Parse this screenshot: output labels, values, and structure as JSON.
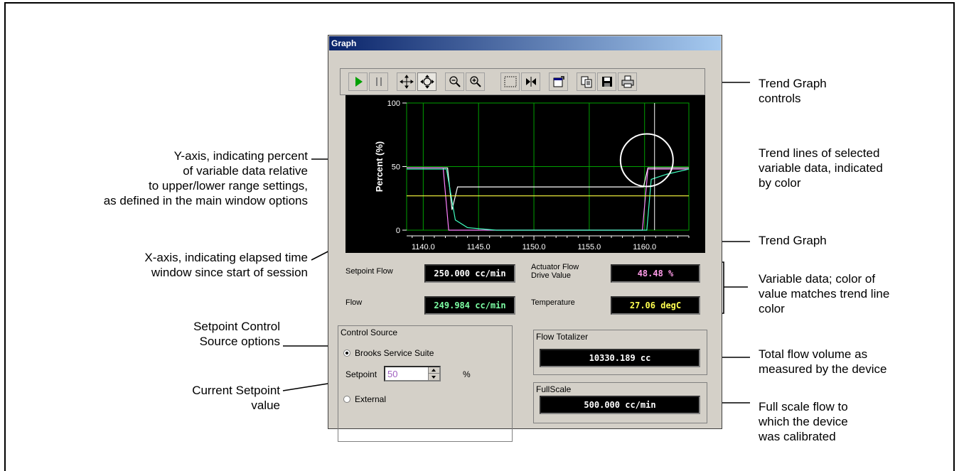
{
  "window": {
    "title": "Graph"
  },
  "toolbar": {
    "buttons": [
      "play-icon",
      "pause-icon",
      "pan-icon",
      "zoom-area-icon",
      "zoom-out-icon",
      "zoom-in-icon",
      "select-box-icon",
      "fit-icon",
      "properties-icon",
      "copy-icon",
      "save-icon",
      "print-icon"
    ]
  },
  "chart_data": {
    "type": "line",
    "ylabel": "Percent (%)",
    "ylim": [
      0,
      100
    ],
    "xlim": [
      1138.5,
      1164.0
    ],
    "y_ticks": [
      "100",
      "50",
      "0"
    ],
    "x_ticks": [
      "1140.0",
      "1145.0",
      "1150.0",
      "1155.0",
      "1160.0"
    ],
    "series": [
      {
        "color": "#ffffff",
        "x": [
          1138.5,
          1142.2,
          1142.6,
          1143.1,
          1159.9,
          1160.3,
          1164.0
        ],
        "y": [
          49,
          49,
          16,
          34,
          34,
          49,
          49
        ]
      },
      {
        "color": "#ff80ff",
        "x": [
          1138.5,
          1141.8,
          1142.3,
          1159.8,
          1160.3,
          1164.0
        ],
        "y": [
          49,
          49,
          0,
          0,
          48,
          48
        ]
      },
      {
        "color": "#40ffc0",
        "x": [
          1138.5,
          1142.1,
          1142.9,
          1144.0,
          1146.6,
          1159.7,
          1160.2,
          1160.6,
          1162.0,
          1164.0
        ],
        "y": [
          48,
          48,
          8,
          2,
          0,
          0,
          0,
          40,
          44,
          48
        ]
      },
      {
        "color": "#ffff40",
        "x": [
          1138.5,
          1164.0
        ],
        "y": [
          27,
          27
        ]
      }
    ]
  },
  "fields": {
    "setpoint_flow": {
      "label": "Setpoint Flow",
      "value": "250.000 cc/min",
      "color": "#ffffff"
    },
    "actuator": {
      "label_1": "Actuator Flow",
      "label_2": "Drive Value",
      "value": "48.48 %",
      "color": "#ff9be8"
    },
    "flow": {
      "label": "Flow",
      "value": "249.984 cc/min",
      "color": "#7dffa4"
    },
    "temperature": {
      "label": "Temperature",
      "value": "27.06 degC",
      "color": "#ffff50"
    }
  },
  "control_source": {
    "title": "Control Source",
    "option_1": "Brooks Service Suite",
    "setpoint_label": "Setpoint",
    "setpoint_value": "50",
    "unit": "%",
    "option_2": "External"
  },
  "flow_totalizer": {
    "title": "Flow Totalizer",
    "value": "10330.189  cc"
  },
  "fullscale": {
    "title": "FullScale",
    "value": "500.000  cc/min"
  },
  "callouts": {
    "y_axis": [
      "Y-axis, indicating percent",
      "of variable data relative",
      "to upper/lower range settings,",
      "as defined in the main window options"
    ],
    "x_axis": [
      "X-axis, indicating elapsed time",
      "window since start of session"
    ],
    "setpoint_control": [
      "Setpoint Control",
      "Source options"
    ],
    "current_setpoint": [
      "Current Setpoint",
      "value"
    ],
    "trend_controls": [
      "Trend Graph",
      "controls"
    ],
    "trend_lines": [
      "Trend lines of selected",
      "variable data, indicated",
      "by color"
    ],
    "trend_graph": [
      "Trend Graph"
    ],
    "variable_data": [
      "Variable data; color of",
      "value matches trend line",
      "color"
    ],
    "total_flow": [
      "Total flow volume as",
      "measured by the device"
    ],
    "full_scale": [
      "Full scale flow to",
      "which the device",
      "was calibrated"
    ]
  }
}
